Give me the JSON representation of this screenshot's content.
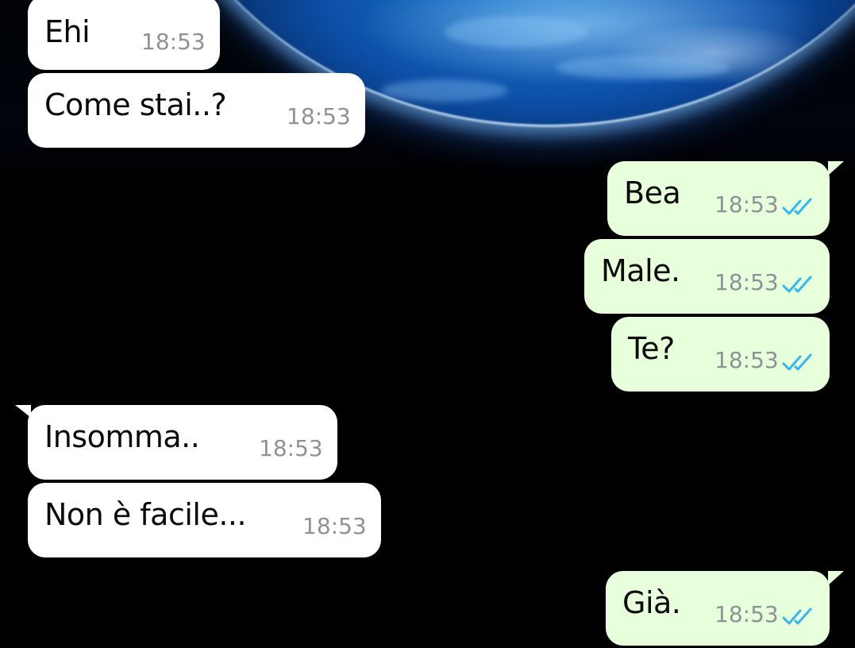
{
  "chat": {
    "messages": [
      {
        "direction": "incoming",
        "text": "Ehi",
        "time": "18:53"
      },
      {
        "direction": "incoming",
        "text": "Come stai..?",
        "time": "18:53"
      },
      {
        "direction": "outgoing",
        "text": "Bea",
        "time": "18:53",
        "status": "read"
      },
      {
        "direction": "outgoing",
        "text": "Male.",
        "time": "18:53",
        "status": "read"
      },
      {
        "direction": "outgoing",
        "text": "Te?",
        "time": "18:53",
        "status": "read"
      },
      {
        "direction": "incoming",
        "text": "Insomma..",
        "time": "18:53"
      },
      {
        "direction": "incoming",
        "text": "Non è facile...",
        "time": "18:53"
      },
      {
        "direction": "outgoing",
        "text": "Già.",
        "time": "18:53",
        "status": "read"
      }
    ]
  },
  "colors": {
    "incoming_bubble": "#ffffff",
    "outgoing_bubble": "#e7ffdb",
    "timestamp": "#8e9296",
    "read_ticks": "#34b7f1",
    "background": "#000000"
  },
  "icons": {
    "read_receipt": "double-check-icon",
    "wallpaper": "earth-wallpaper"
  }
}
